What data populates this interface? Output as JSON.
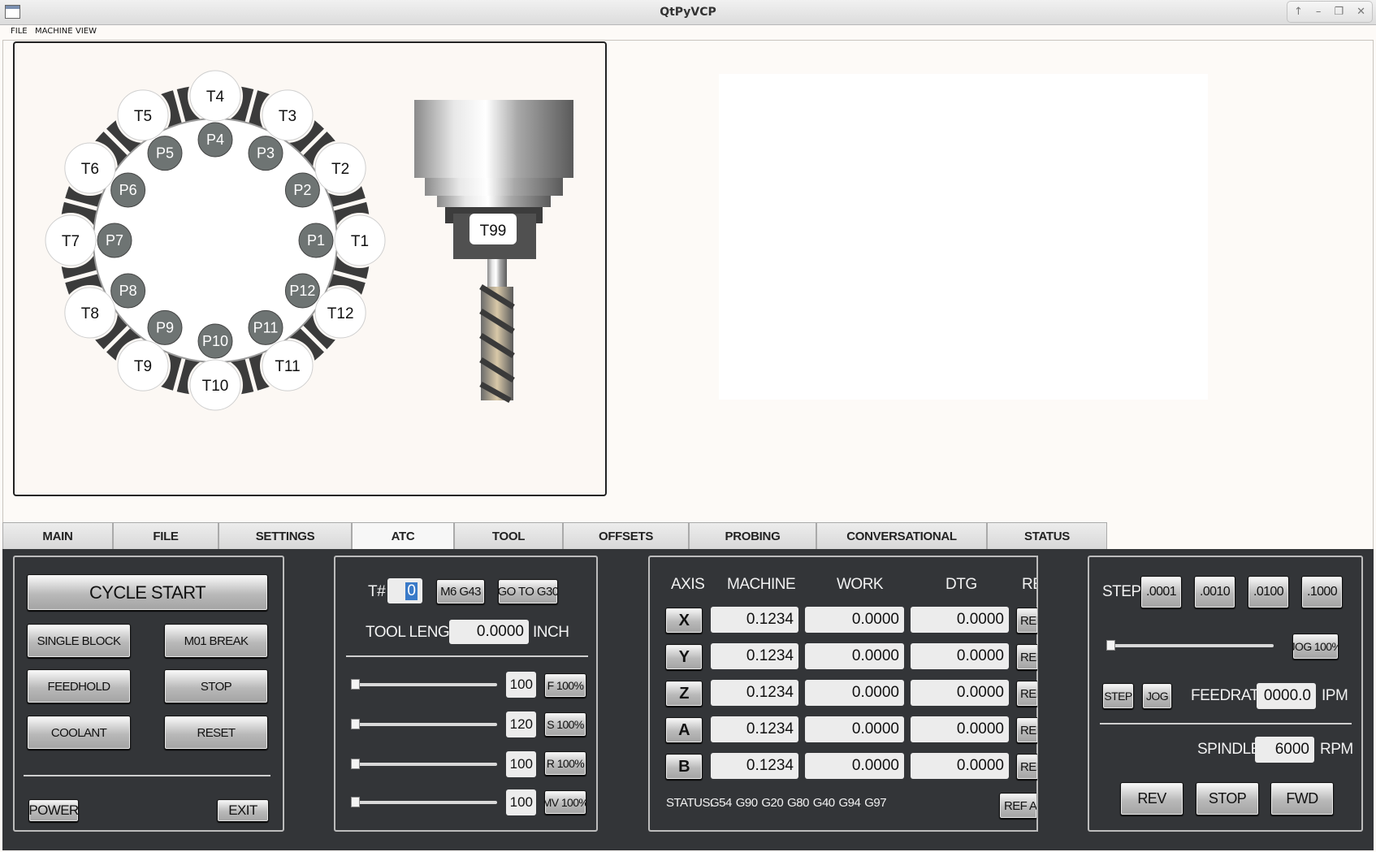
{
  "window": {
    "title": "QtPyVCP",
    "controls": [
      "↑",
      "–",
      "❐",
      "✕"
    ]
  },
  "menu": [
    "FILE",
    "MACHINE",
    "VIEW"
  ],
  "carousel": {
    "tools": [
      "T1",
      "T2",
      "T3",
      "T4",
      "T5",
      "T6",
      "T7",
      "T8",
      "T9",
      "T10",
      "T11",
      "T12"
    ],
    "pockets": [
      "P1",
      "P2",
      "P3",
      "P4",
      "P5",
      "P6",
      "P7",
      "P8",
      "P9",
      "P10",
      "P11",
      "P12"
    ],
    "spindle_tool": "T99"
  },
  "tabs": [
    "MAIN",
    "FILE",
    "SETTINGS",
    "ATC",
    "TOOL",
    "OFFSETS",
    "PROBING",
    "CONVERSATIONAL",
    "STATUS"
  ],
  "active_tab": "ATC",
  "control": {
    "cycle_start": "CYCLE START",
    "single_block": "SINGLE BLOCK",
    "m01_break": "M01 BREAK",
    "feedhold": "FEEDHOLD",
    "stop": "STOP",
    "coolant": "COOLANT",
    "reset": "RESET",
    "power": "POWER",
    "exit": "EXIT"
  },
  "tool_panel": {
    "tnum_label": "T#",
    "tnum_value": "0",
    "m6g43": "M6 G43",
    "goto_g30": "GO TO G30",
    "tool_length_label": "TOOL LENGTH",
    "tool_length_value": "0.0000",
    "tool_length_unit": "INCH",
    "overrides": [
      {
        "value": "100",
        "button": "F 100%",
        "fraction": 0.0
      },
      {
        "value": "120",
        "button": "S 100%",
        "fraction": 0.0
      },
      {
        "value": "100",
        "button": "R 100%",
        "fraction": 0.0
      },
      {
        "value": "100",
        "button": "MV 100%",
        "fraction": 0.0
      }
    ]
  },
  "dro": {
    "headers": [
      "AXIS",
      "MACHINE",
      "WORK",
      "DTG",
      "RE"
    ],
    "rows": [
      {
        "axis": "X",
        "machine": "0.1234",
        "work": "0.0000",
        "dtg": "0.0000",
        "ref": "REF"
      },
      {
        "axis": "Y",
        "machine": "0.1234",
        "work": "0.0000",
        "dtg": "0.0000",
        "ref": "REF"
      },
      {
        "axis": "Z",
        "machine": "0.1234",
        "work": "0.0000",
        "dtg": "0.0000",
        "ref": "REF"
      },
      {
        "axis": "A",
        "machine": "0.1234",
        "work": "0.0000",
        "dtg": "0.0000",
        "ref": "REF"
      },
      {
        "axis": "B",
        "machine": "0.1234",
        "work": "0.0000",
        "dtg": "0.0000",
        "ref": "REF"
      }
    ],
    "status_label": "STATUS:",
    "gcodes": [
      "G54",
      "G90",
      "G20",
      "G80",
      "G40",
      "G94",
      "G97"
    ],
    "ref_all": "REF AL"
  },
  "jog": {
    "step_label": "STEP",
    "steps": [
      ".0001",
      ".0010",
      ".0100",
      ".1000"
    ],
    "jog_button": "JOG 100%",
    "jog_fraction": 0.0,
    "step_btn": "STEP",
    "jog_btn": "JOG",
    "feedrate_label": "FEEDRATE",
    "feedrate_value": "0000.0",
    "feedrate_unit": "IPM",
    "spindle_label": "SPINDLE",
    "spindle_value": "6000",
    "spindle_unit": "RPM",
    "rev": "REV",
    "stop": "STOP",
    "fwd": "FWD"
  }
}
